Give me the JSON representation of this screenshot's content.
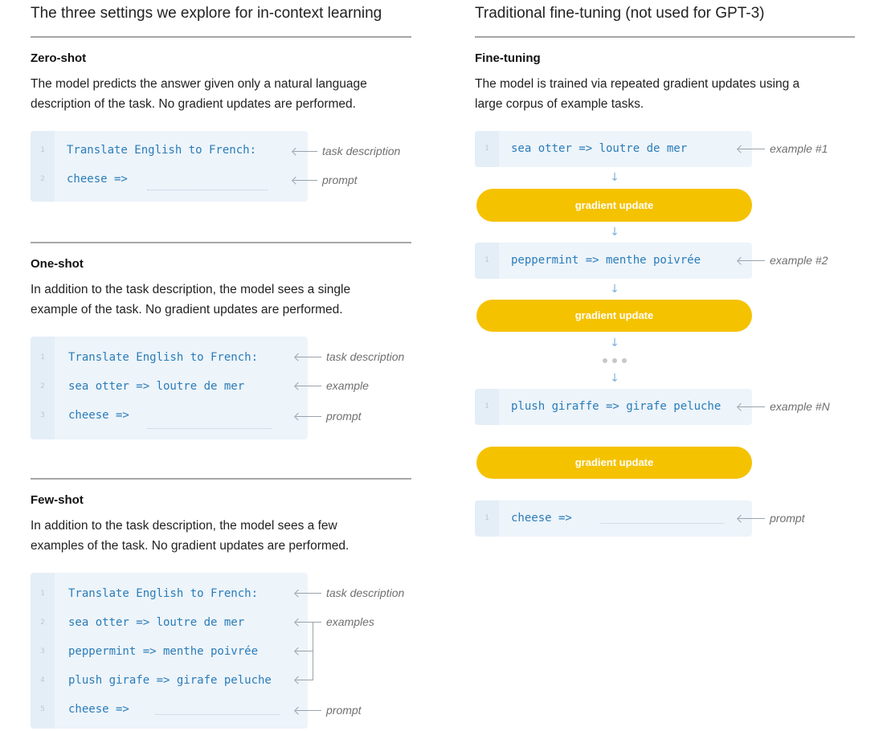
{
  "left": {
    "title": "The three settings we explore for in-context learning",
    "sections": [
      {
        "heading": "Zero-shot",
        "desc": [
          "The model predicts the answer given only a natural language",
          "description of the task. No gradient updates are performed."
        ],
        "lines": [
          {
            "n": "1",
            "code": "Translate English to French:",
            "ann": "task description"
          },
          {
            "n": "2",
            "code": "cheese =>",
            "ann": "prompt"
          }
        ]
      },
      {
        "heading": "One-shot",
        "desc": [
          "In addition to the task description, the model sees a single",
          "example of the task. No gradient updates are performed."
        ],
        "lines": [
          {
            "n": "1",
            "code": "Translate English to French:",
            "ann": "task description"
          },
          {
            "n": "2",
            "code": "sea otter => loutre de mer",
            "ann": "example"
          },
          {
            "n": "3",
            "code": "cheese =>",
            "ann": "prompt"
          }
        ]
      },
      {
        "heading": "Few-shot",
        "desc": [
          "In addition to the task description, the model sees a few",
          "examples of the task. No gradient updates are performed."
        ],
        "lines": [
          {
            "n": "1",
            "code": "Translate English to French:",
            "ann": "task description"
          },
          {
            "n": "2",
            "code": "sea otter => loutre de mer",
            "ann": "examples"
          },
          {
            "n": "3",
            "code": "peppermint => menthe poivrée",
            "ann": ""
          },
          {
            "n": "4",
            "code": "plush girafe => girafe peluche",
            "ann": ""
          },
          {
            "n": "5",
            "code": "cheese =>",
            "ann": "prompt"
          }
        ]
      }
    ]
  },
  "right": {
    "title": "Traditional fine-tuning (not used for GPT-3)",
    "heading": "Fine-tuning",
    "desc": [
      "The model is trained via repeated gradient updates using a",
      "large corpus of example tasks."
    ],
    "steps": [
      {
        "n": "1",
        "code": "sea otter => loutre de mer",
        "ann": "example #1"
      },
      {
        "n": "1",
        "code": "peppermint => menthe poivrée",
        "ann": "example #2"
      },
      {
        "n": "1",
        "code": "plush giraffe => girafe peluche",
        "ann": "example #N"
      },
      {
        "n": "1",
        "code": "cheese =>",
        "ann": "prompt"
      }
    ],
    "gradient_label": "gradient update",
    "arrow_glyph": "↓"
  },
  "colors": {
    "code_text": "#2a7cb8",
    "box_bg": "#edf4fa",
    "gradient_bg": "#f5c200",
    "annotation": "#6f6f6f"
  }
}
